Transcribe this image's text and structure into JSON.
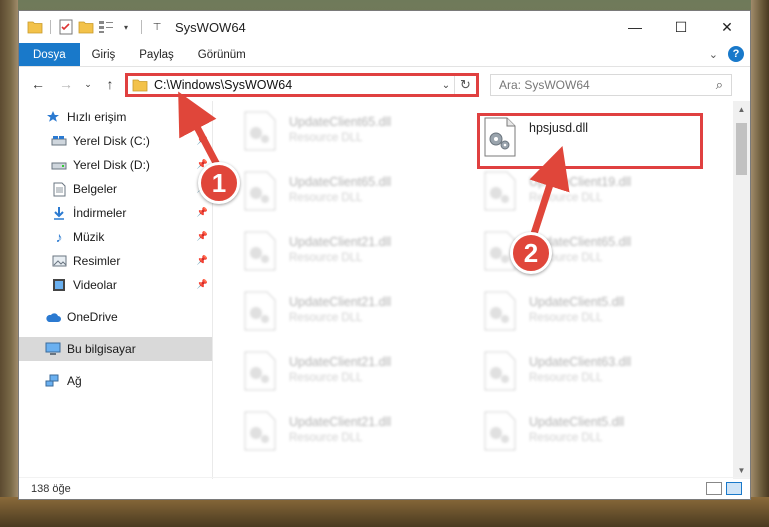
{
  "window": {
    "title": "SysWOW64"
  },
  "ribbon": {
    "tabs": [
      "Dosya",
      "Giriş",
      "Paylaş",
      "Görünüm"
    ]
  },
  "address": {
    "path": "C:\\Windows\\SysWOW64"
  },
  "search": {
    "placeholder": "Ara: SysWOW64"
  },
  "sidebar": {
    "items": [
      {
        "label": "Hızlı erişim",
        "icon": "star-icon",
        "pinned": false
      },
      {
        "label": "Yerel Disk (C:)",
        "icon": "drive-icon",
        "pinned": true
      },
      {
        "label": "Yerel Disk (D:)",
        "icon": "drive-icon",
        "pinned": true
      },
      {
        "label": "Belgeler",
        "icon": "documents-icon",
        "pinned": true
      },
      {
        "label": "İndirmeler",
        "icon": "download-icon",
        "pinned": true
      },
      {
        "label": "Müzik",
        "icon": "music-icon",
        "pinned": true
      },
      {
        "label": "Resimler",
        "icon": "pictures-icon",
        "pinned": true
      },
      {
        "label": "Videolar",
        "icon": "videos-icon",
        "pinned": true
      },
      {
        "label": "OneDrive",
        "icon": "onedrive-icon",
        "pinned": false
      },
      {
        "label": "Bu bilgisayar",
        "icon": "computer-icon",
        "pinned": false,
        "selected": true
      },
      {
        "label": "Ağ",
        "icon": "network-icon",
        "pinned": false
      }
    ]
  },
  "files": {
    "left": [
      {
        "name": "UpdateClient65.dll",
        "type": "Resource DLL"
      },
      {
        "name": "UpdateClient65.dll",
        "type": "Resource DLL"
      },
      {
        "name": "UpdateClient21.dll",
        "type": "Resource DLL"
      },
      {
        "name": "UpdateClient21.dll",
        "type": "Resource DLL"
      },
      {
        "name": "UpdateClient21.dll",
        "type": "Resource DLL"
      },
      {
        "name": "UpdateClient21.dll",
        "type": "Resource DLL"
      }
    ],
    "right": [
      {
        "name": "hpsjusd.dll",
        "type": "",
        "highlighted": true
      },
      {
        "name": "UpdateClient19.dll",
        "type": "Resource DLL"
      },
      {
        "name": "UpdateClient65.dll",
        "type": "Resource DLL"
      },
      {
        "name": "UpdateClient5.dll",
        "type": "Resource DLL"
      },
      {
        "name": "UpdateClient63.dll",
        "type": "Resource DLL"
      },
      {
        "name": "UpdateClient5.dll",
        "type": "Resource DLL"
      }
    ]
  },
  "status": {
    "count": "138 öğe"
  },
  "callouts": {
    "one": "1",
    "two": "2"
  },
  "colors": {
    "accent": "#1979ca",
    "highlight": "#e04040",
    "callout": "#e0463a"
  }
}
